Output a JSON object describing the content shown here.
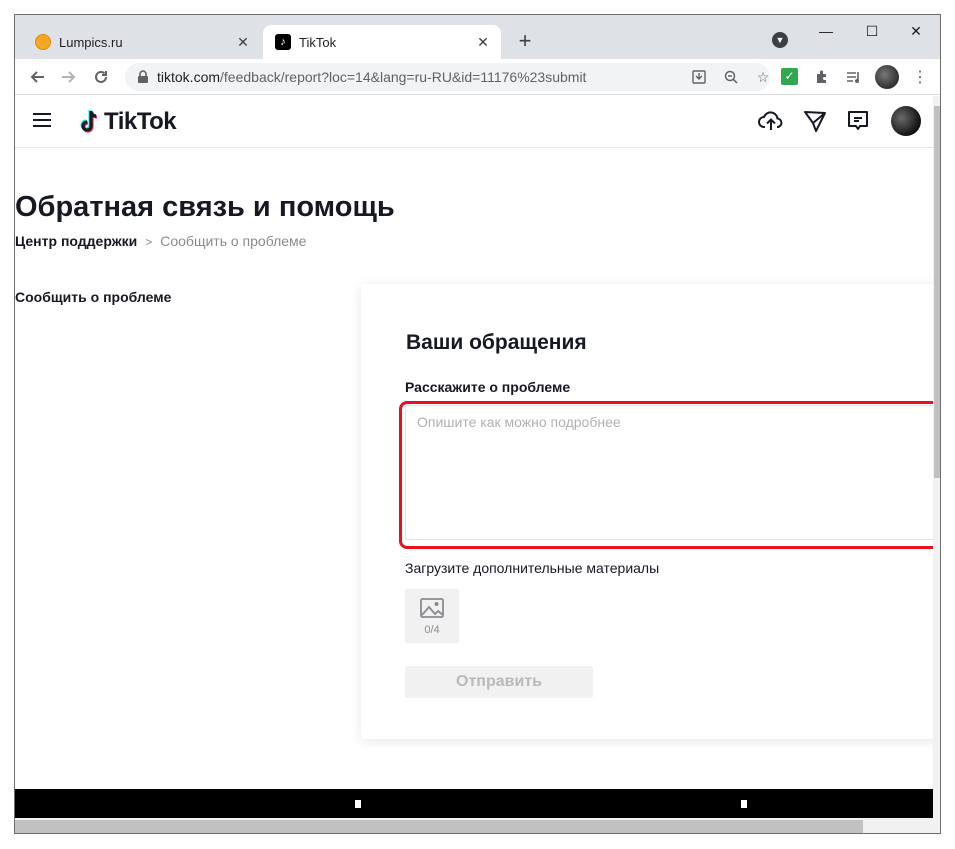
{
  "browser": {
    "tabs": [
      {
        "title": "Lumpics.ru",
        "active": false
      },
      {
        "title": "TikTok",
        "active": true
      }
    ],
    "tab_close_glyph": "✕",
    "new_tab_glyph": "+",
    "url": {
      "host": "tiktok.com",
      "path": "/feedback/report?loc=14&lang=ru-RU&id=11176%23submit"
    },
    "window_controls": {
      "minimize": "—",
      "maximize": "☐",
      "close": "✕"
    }
  },
  "header": {
    "logo_text": "TikTok"
  },
  "page": {
    "title": "Обратная связь и помощь",
    "breadcrumb": {
      "first": "Центр поддержки",
      "separator": ">",
      "current": "Сообщить о проблеме"
    },
    "sidebar": {
      "items": [
        {
          "label": "Сообщить о проблеме"
        }
      ]
    },
    "form": {
      "heading": "Ваши обращения",
      "problem_label": "Расскажите о проблеме",
      "problem_placeholder": "Опишите как можно подробнее",
      "problem_value": "",
      "upload_label": "Загрузите дополнительные материалы",
      "upload_count": "0/4",
      "submit_label": "Отправить"
    }
  },
  "colors": {
    "highlight": "#e8101f",
    "text_primary": "#161823",
    "text_secondary": "#8a8b91"
  }
}
